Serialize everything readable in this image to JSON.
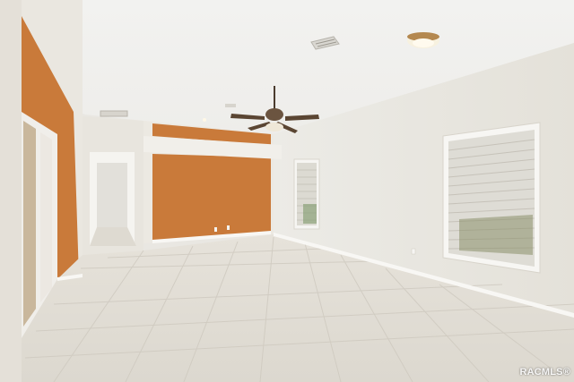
{
  "watermark": {
    "text": "RACMLS®"
  },
  "colors": {
    "accent_wall": "#c97a3a",
    "walls": "#ebe7df",
    "ceiling": "#f3f2ef",
    "floor_tile": "#e3dfd6",
    "baseboard": "#f7f6f3"
  },
  "icons": [
    "ceiling-fan-icon",
    "ceiling-light-icon",
    "air-vent-icon"
  ]
}
